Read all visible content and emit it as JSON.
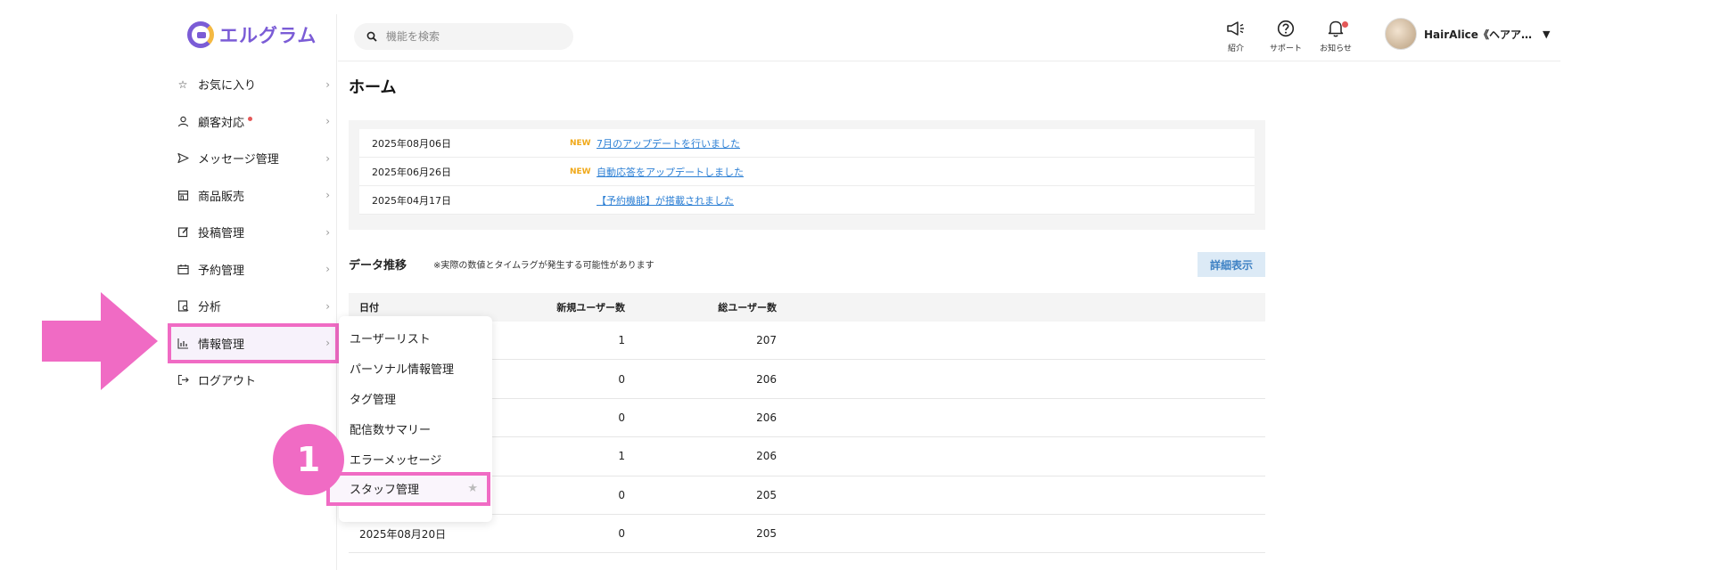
{
  "app": {
    "logo_text": "エルグラム",
    "accent": "#7b5cd6",
    "highlight": "#f06bc4"
  },
  "sidebar": {
    "items": [
      {
        "label": "お気に入り",
        "icon": "star-icon"
      },
      {
        "label": "顧客対応",
        "icon": "person-icon",
        "badge_dot": true
      },
      {
        "label": "メッセージ管理",
        "icon": "send-icon"
      },
      {
        "label": "商品販売",
        "icon": "shop-icon"
      },
      {
        "label": "投稿管理",
        "icon": "edit-icon"
      },
      {
        "label": "予約管理",
        "icon": "calendar-icon"
      },
      {
        "label": "分析",
        "icon": "report-icon"
      },
      {
        "label": "情報管理",
        "icon": "bar-chart-icon",
        "active": true
      },
      {
        "label": "ログアウト",
        "icon": "logout-icon"
      }
    ]
  },
  "header": {
    "search_placeholder": "機能を検索",
    "icons": [
      {
        "label": "紹介",
        "icon": "megaphone-icon"
      },
      {
        "label": "サポート",
        "icon": "help-icon"
      },
      {
        "label": "お知らせ",
        "icon": "bell-icon",
        "notification_dot": true
      }
    ],
    "user_name": "HairAlice《ヘアア…"
  },
  "main": {
    "title": "ホーム",
    "news": [
      {
        "date": "2025年08月06日",
        "new": "NEW",
        "text": "7月のアップデートを行いました"
      },
      {
        "date": "2025年06月26日",
        "new": "NEW",
        "text": "自動応答をアップデートしました"
      },
      {
        "date": "2025年04月17日",
        "new": "",
        "text": "【予約機能】が搭載されました"
      }
    ],
    "data_section": {
      "title": "データ推移",
      "note": "※実際の数値とタイムラグが発生する可能性があります",
      "detail_button": "詳細表示"
    },
    "table": {
      "headers": [
        "日付",
        "新規ユーザー数",
        "総ユーザー数"
      ],
      "rows": [
        {
          "date": "",
          "new_users": "1",
          "total_users": "207"
        },
        {
          "date": "",
          "new_users": "0",
          "total_users": "206"
        },
        {
          "date": "",
          "new_users": "0",
          "total_users": "206"
        },
        {
          "date": "",
          "new_users": "1",
          "total_users": "206"
        },
        {
          "date": "",
          "new_users": "0",
          "total_users": "205"
        },
        {
          "date": "2025年08月20日",
          "new_users": "0",
          "total_users": "205"
        }
      ]
    }
  },
  "submenu": {
    "items": [
      {
        "label": "ユーザーリスト"
      },
      {
        "label": "パーソナル情報管理"
      },
      {
        "label": "タグ管理"
      },
      {
        "label": "配信数サマリー"
      },
      {
        "label": "エラーメッセージ"
      },
      {
        "label": "スタッフ管理",
        "active": true,
        "icon": "star-icon"
      }
    ]
  },
  "annotation": {
    "step_number": "1"
  }
}
